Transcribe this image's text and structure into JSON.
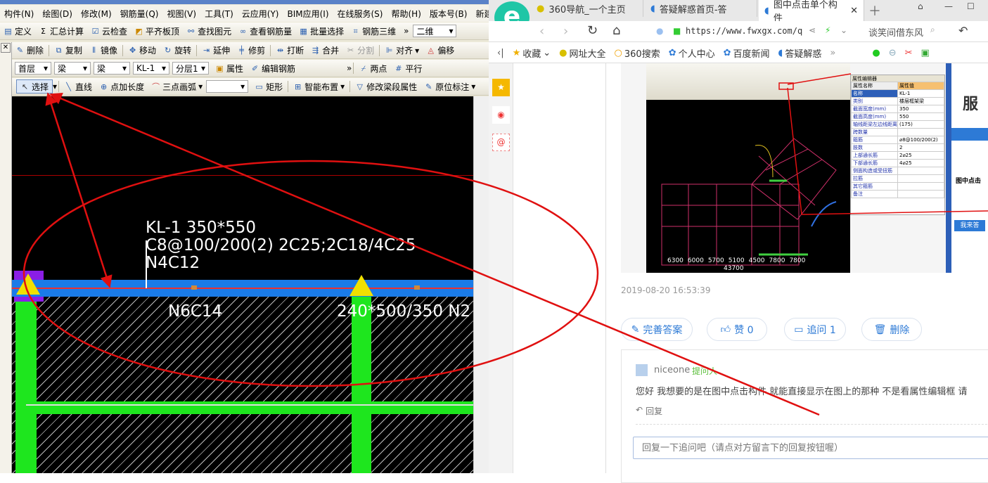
{
  "app": {
    "menu": [
      "构件(N)",
      "绘图(D)",
      "修改(M)",
      "钢筋量(Q)",
      "视图(V)",
      "工具(T)",
      "云应用(Y)",
      "BIM应用(I)",
      "在线服务(S)",
      "帮助(H)",
      "版本号(B)",
      "新建"
    ],
    "toolbar1": [
      "定义",
      "汇总计算",
      "云检查",
      "平齐板顶",
      "查找图元",
      "查看钢筋量",
      "批量选择",
      "钢筋三维",
      "二维"
    ],
    "toolbar2": [
      "删除",
      "复制",
      "镜像",
      "移动",
      "旋转",
      "延伸",
      "修剪",
      "打断",
      "合并",
      "分割",
      "对齐",
      "偏移"
    ],
    "toolbar3": {
      "floor": "首层",
      "type1": "梁",
      "type2": "梁",
      "element": "KL-1",
      "layer": "分层1",
      "properties": "属性",
      "edit_rebar": "编辑钢筋",
      "two_point": "两点",
      "parallel": "平行"
    },
    "toolbar4": [
      "选择",
      "直线",
      "点加长度",
      "三点画弧",
      "矩形",
      "智能布置",
      "修改梁段属性",
      "原位标注"
    ],
    "canvas": {
      "beam_label_1": "KL-1 350*550",
      "beam_label_2": "C8@100/200(2) 2C25;2C18/4C25",
      "beam_label_3": "N4C12",
      "span_label": "N6C14",
      "span_label_2": "240*500/350 N2"
    },
    "annotation_color": "#e01010"
  },
  "browser": {
    "tabs": [
      {
        "label": "360导航_一个主页"
      },
      {
        "label": "答疑解惑首页-答"
      },
      {
        "label": "图中点击单个构件",
        "active": true
      }
    ],
    "url": "https://www.fwxgx.com/q",
    "search_hint": "谈笑间借东风",
    "bookmarks": [
      "收藏",
      "网址大全",
      "360搜索",
      "个人中心",
      "百度新闻",
      "答疑解惑"
    ],
    "embedded": {
      "property_panel_title": "属性编辑器",
      "headers": [
        "属性名称",
        "属性值"
      ],
      "rows": [
        [
          "名称",
          "KL-1"
        ],
        [
          "类别",
          "楼层框架梁"
        ],
        [
          "截面宽度(mm)",
          "350"
        ],
        [
          "截面高度(mm)",
          "550"
        ],
        [
          "轴线距梁左边线距离",
          "(175)"
        ],
        [
          "跨数量",
          ""
        ],
        [
          "箍筋",
          "⌀8@100/200(2)"
        ],
        [
          "肢数",
          "2"
        ],
        [
          "上部通长筋",
          "2⌀25"
        ],
        [
          "下部通长筋",
          "4⌀25"
        ],
        [
          "侧面构造或受扭筋",
          ""
        ],
        [
          "拉筋",
          ""
        ],
        [
          "其它箍筋",
          ""
        ],
        [
          "备注",
          ""
        ]
      ],
      "dims": [
        "6300",
        "6000",
        "5700",
        "5100",
        "4500",
        "7800",
        "7800"
      ],
      "total": "43700",
      "side_logo": "服",
      "side_heading": "图中点击",
      "side_button": "我来答"
    },
    "timestamp": "2019-08-20 16:53:39",
    "actions": {
      "improve": "完善答案",
      "like": "赞 0",
      "followup": "追问 1",
      "delete": "删除"
    },
    "comment": {
      "user": "niceone",
      "role": "提问人",
      "text": "您好 我想要的是在图中点击构件 就能直接显示在图上的那种 不是看属性编辑框 请",
      "reply": "回复",
      "reply_placeholder": "回复一下追问吧（请点对方留言下的回复按钮喔）"
    }
  }
}
